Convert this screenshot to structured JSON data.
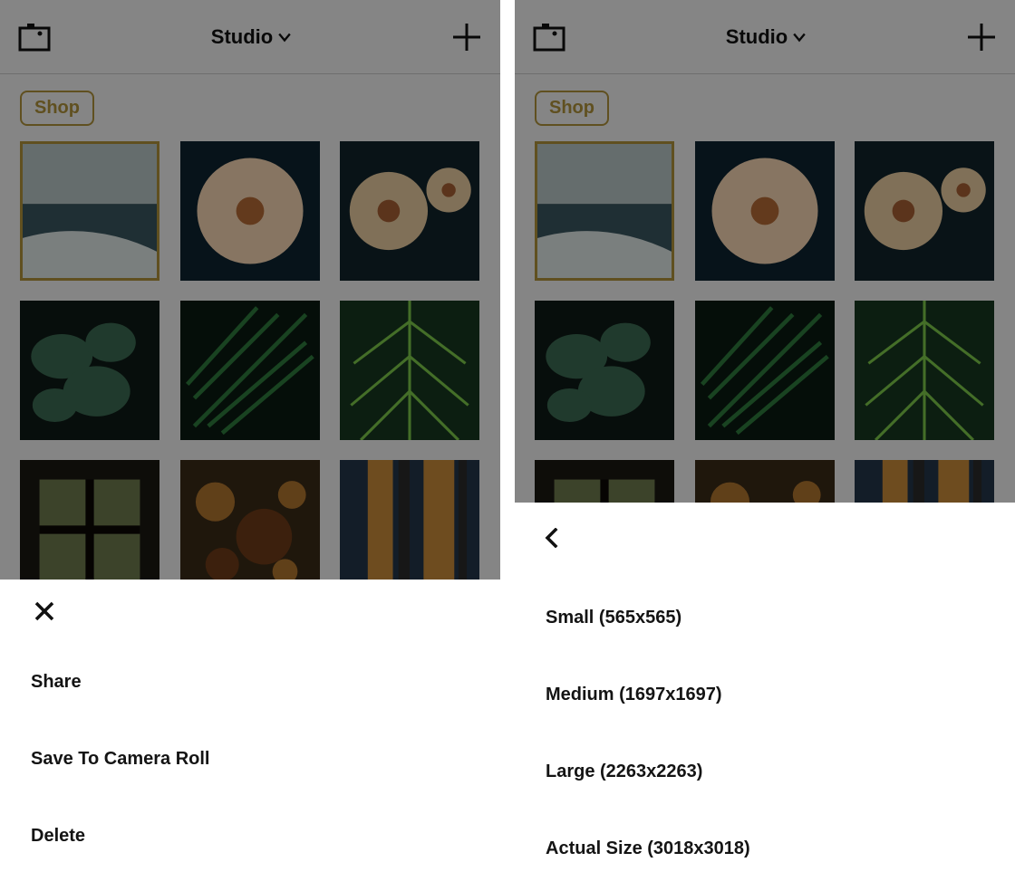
{
  "header": {
    "title": "Studio",
    "shop_label": "Shop"
  },
  "left_sheet": {
    "items": [
      {
        "label": "Share"
      },
      {
        "label": "Save To Camera Roll"
      },
      {
        "label": "Delete"
      }
    ]
  },
  "right_sheet": {
    "items": [
      {
        "label": "Small (565x565)"
      },
      {
        "label": "Medium (1697x1697)"
      },
      {
        "label": "Large (2263x2263)"
      },
      {
        "label": "Actual Size (3018x3018)"
      }
    ]
  }
}
